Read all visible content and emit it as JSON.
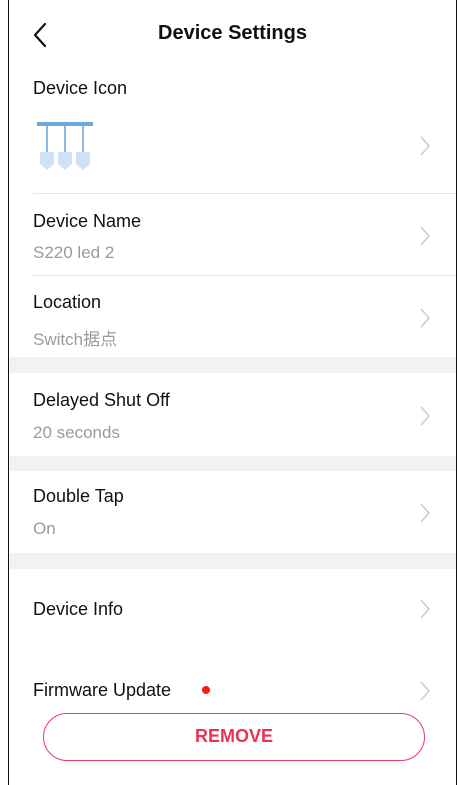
{
  "header": {
    "title": "Device Settings"
  },
  "device_icon": {
    "label": "Device Icon",
    "icon": "pendant-lights-icon"
  },
  "device_name": {
    "label": "Device Name",
    "value": "S220 led 2"
  },
  "location": {
    "label": "Location",
    "value": "Switch据点"
  },
  "delayed_shut_off": {
    "label": "Delayed Shut Off",
    "value": "20 seconds"
  },
  "double_tap": {
    "label": "Double Tap",
    "value": "On"
  },
  "device_info": {
    "label": "Device Info"
  },
  "firmware_update": {
    "label": "Firmware Update",
    "has_update_indicator": true
  },
  "remove_button": {
    "label": "REMOVE"
  },
  "colors": {
    "accent": "#e8325c",
    "update_dot": "#ff1a1a",
    "secondary_text": "#9a9a9a",
    "section_band": "#f2f2f2",
    "icon_blue": "#6fa8dc"
  }
}
